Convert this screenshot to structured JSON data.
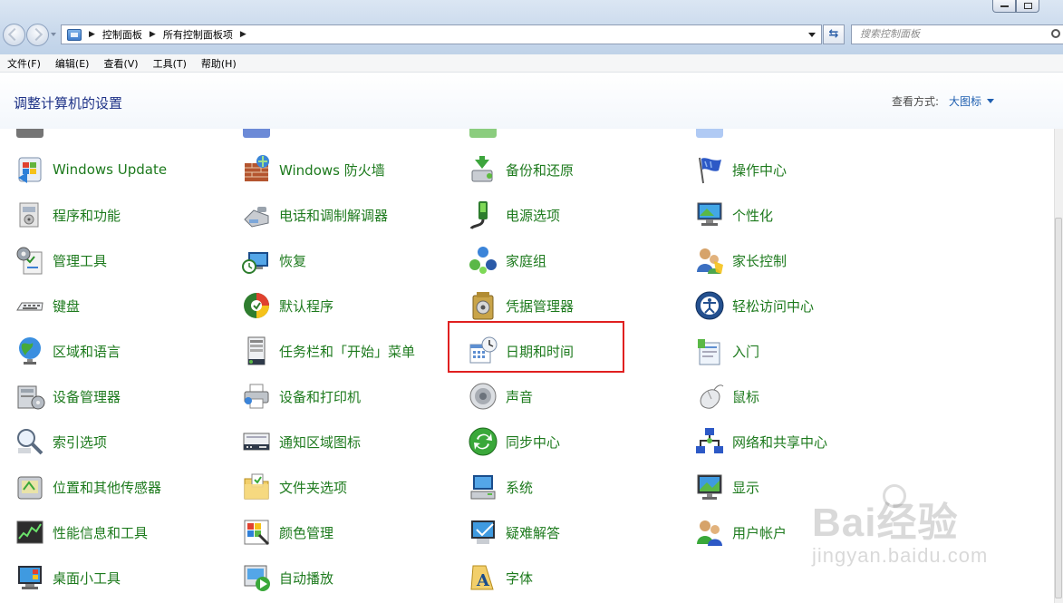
{
  "breadcrumb": [
    "控制面板",
    "所有控制面板项"
  ],
  "search": {
    "placeholder": "搜索控制面板"
  },
  "menu": [
    "文件(F)",
    "编辑(E)",
    "查看(V)",
    "工具(T)",
    "帮助(H)"
  ],
  "header": {
    "title": "调整计算机的设置",
    "view_by_label": "查看方式:",
    "view_by_value": "大图标"
  },
  "items": [
    {
      "label": "Windows Update",
      "icon": "windows-update-icon"
    },
    {
      "label": "Windows 防火墙",
      "icon": "firewall-icon"
    },
    {
      "label": "备份和还原",
      "icon": "backup-icon"
    },
    {
      "label": "操作中心",
      "icon": "flag-icon"
    },
    {
      "label": "程序和功能",
      "icon": "programs-icon"
    },
    {
      "label": "电话和调制解调器",
      "icon": "phone-icon"
    },
    {
      "label": "电源选项",
      "icon": "power-icon"
    },
    {
      "label": "个性化",
      "icon": "personalize-icon"
    },
    {
      "label": "管理工具",
      "icon": "admin-tools-icon"
    },
    {
      "label": "恢复",
      "icon": "recovery-icon"
    },
    {
      "label": "家庭组",
      "icon": "homegroup-icon"
    },
    {
      "label": "家长控制",
      "icon": "parental-icon"
    },
    {
      "label": "键盘",
      "icon": "keyboard-icon"
    },
    {
      "label": "默认程序",
      "icon": "default-programs-icon"
    },
    {
      "label": "凭据管理器",
      "icon": "credential-icon"
    },
    {
      "label": "轻松访问中心",
      "icon": "accessibility-icon"
    },
    {
      "label": "区域和语言",
      "icon": "globe-icon"
    },
    {
      "label": "任务栏和「开始」菜单",
      "icon": "taskbar-icon"
    },
    {
      "label": "日期和时间",
      "icon": "calendar-clock-icon"
    },
    {
      "label": "入门",
      "icon": "getting-started-icon"
    },
    {
      "label": "设备管理器",
      "icon": "device-manager-icon"
    },
    {
      "label": "设备和打印机",
      "icon": "printer-icon"
    },
    {
      "label": "声音",
      "icon": "speaker-icon"
    },
    {
      "label": "鼠标",
      "icon": "mouse-icon"
    },
    {
      "label": "索引选项",
      "icon": "index-icon"
    },
    {
      "label": "通知区域图标",
      "icon": "notification-icon"
    },
    {
      "label": "同步中心",
      "icon": "sync-icon"
    },
    {
      "label": "网络和共享中心",
      "icon": "network-icon"
    },
    {
      "label": "位置和其他传感器",
      "icon": "sensor-icon"
    },
    {
      "label": "文件夹选项",
      "icon": "folder-icon"
    },
    {
      "label": "系统",
      "icon": "system-icon"
    },
    {
      "label": "显示",
      "icon": "display-icon"
    },
    {
      "label": "性能信息和工具",
      "icon": "performance-icon"
    },
    {
      "label": "颜色管理",
      "icon": "color-icon"
    },
    {
      "label": "疑难解答",
      "icon": "troubleshoot-icon"
    },
    {
      "label": "用户帐户",
      "icon": "users-icon"
    },
    {
      "label": "桌面小工具",
      "icon": "gadgets-icon"
    },
    {
      "label": "自动播放",
      "icon": "autoplay-icon"
    },
    {
      "label": "字体",
      "icon": "font-icon"
    }
  ],
  "watermark": {
    "main": "Bai经验",
    "sub": "jingyan.baidu.com"
  }
}
